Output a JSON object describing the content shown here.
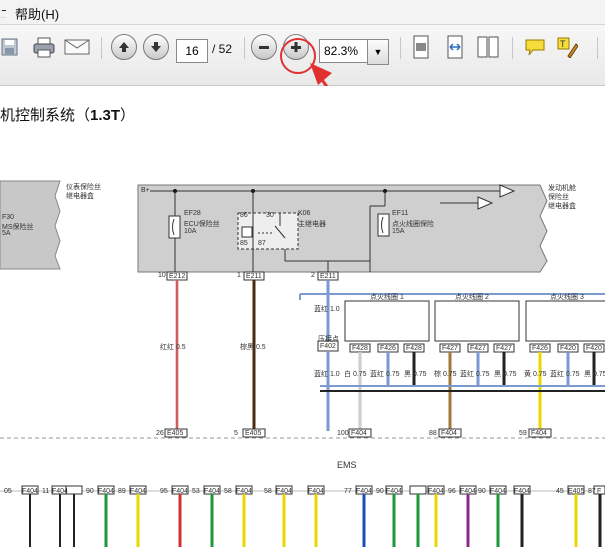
{
  "menu": {
    "partial_left": "二",
    "help": "帮助(H)"
  },
  "toolbar": {
    "page_current": "16",
    "page_total": "/ 52",
    "zoom_value": "82.3%",
    "icons": [
      "save-icon",
      "print-icon",
      "email-icon",
      "previous-page-icon",
      "next-page-icon",
      "zoom-out-icon",
      "zoom-in-icon",
      "fit-page-icon",
      "fit-width-icon",
      "two-page-icon",
      "comment-icon",
      "highlight-icon"
    ]
  },
  "annotation": {
    "color": "#e03030"
  },
  "document": {
    "title_prefix": "机控制系统（",
    "title_model": "1.3T",
    "title_suffix": "）",
    "left_box_label1": "仪表保险丝",
    "left_box_label2": "继电器盒",
    "left_fuse_id": "F30",
    "left_fuse_name": "MS保险丝",
    "left_fuse_amp": "5A",
    "battery_label": "B+",
    "fuse_ef28_id": "EF28",
    "fuse_ef28_name": "ECU保险丝",
    "fuse_ef28_amp": "10A",
    "relay_id": "K06",
    "relay_name": "主继电器",
    "relay_pin30": "30",
    "relay_pin86": "86",
    "relay_pin85": "85",
    "relay_pin87": "87",
    "fuse_ef11_id": "EF11",
    "fuse_ef11_name": "点火线圈保险",
    "fuse_ef11_amp": "15A",
    "right_box_label1": "发动机舱",
    "right_box_label2": "保险丝",
    "right_box_label3": "继电器盒",
    "conn_e212": "E212",
    "conn_e211a": "E211",
    "conn_e211b": "E211",
    "pin_10": "10",
    "pin_1": "1",
    "pin_2": "2",
    "wire_red": "红红 0.5",
    "wire_brown": "棕黑 0.5",
    "wire_blue": "蓝红 1.0",
    "wire_blue2": "蓝红 1.0",
    "splice_label": "压接点",
    "splice_id": "F402",
    "coil1_label": "点火线圈 1",
    "coil2_label": "点火线圈 2",
    "coil3_label": "点火线圈 3",
    "coil_conn1": "F428",
    "coil_conn2": "F426",
    "coil_conn3": "F428",
    "coil_conn4": "F427",
    "coil_conn5": "F427",
    "coil_conn6": "F427",
    "coil_conn7": "F426",
    "coil_conn8": "F420",
    "coil_conn9": "F420",
    "wire_a": "白 0.75",
    "wire_b": "蓝红 0.75",
    "wire_c": "黑 0.75",
    "wire_d": "棕 0.75",
    "wire_e": "蓝红 0.75",
    "wire_f": "黑 0.75",
    "wire_g": "黄 0.75",
    "wire_h": "蓝红 0.75",
    "wire_i": "黑 0.75",
    "bot_e405a": "E405",
    "bot_e405b": "E405",
    "bot_f404a": "F404",
    "bot_f404b": "F404",
    "bot_f404c": "F404",
    "bot_pin26": "26",
    "bot_pin5": "5",
    "bot_pin100": "100",
    "bot_pin88": "88",
    "bot_pin59": "59",
    "ems_label": "EMS",
    "bottom_row": [
      {
        "pin": "05",
        "conn": "F404"
      },
      {
        "pin": "11",
        "conn": "F404"
      },
      {
        "pin": "112",
        "conn": "F404"
      },
      {
        "pin": "90",
        "conn": "F404"
      },
      {
        "pin": "89",
        "conn": "F404"
      },
      {
        "pin": "95",
        "conn": "F404"
      },
      {
        "pin": "53",
        "conn": "F404"
      },
      {
        "pin": "58",
        "conn": "F404"
      },
      {
        "pin": "56",
        "conn": "F404"
      },
      {
        "pin": "58",
        "conn": "F404"
      },
      {
        "pin": "",
        "conn": "F404"
      },
      {
        "pin": "77",
        "conn": "F404"
      },
      {
        "pin": "90",
        "conn": "F404"
      },
      {
        "pin": "78",
        "conn": "F404"
      },
      {
        "pin": "",
        "conn": "F404"
      },
      {
        "pin": "96",
        "conn": "F404"
      },
      {
        "pin": "90",
        "conn": "F404"
      },
      {
        "pin": "87",
        "conn": "F404"
      },
      {
        "pin": "45",
        "conn": "E405"
      },
      {
        "pin": "87",
        "conn": "F"
      }
    ],
    "bottom_colors": [
      "#222222",
      "#222222",
      "#222222",
      "#1a9a3a",
      "#e8d800",
      "#d43030",
      "#1a9a3a",
      "#e8d800",
      "#e8d800",
      "#e8d800",
      "#bbbbbb",
      "#1b4fbf",
      "#1a9a3a",
      "#1a9a3a",
      "#e8d800",
      "#8b2a8b",
      "#1a9a3a",
      "#222222",
      "#e8d800",
      "#222222"
    ]
  }
}
